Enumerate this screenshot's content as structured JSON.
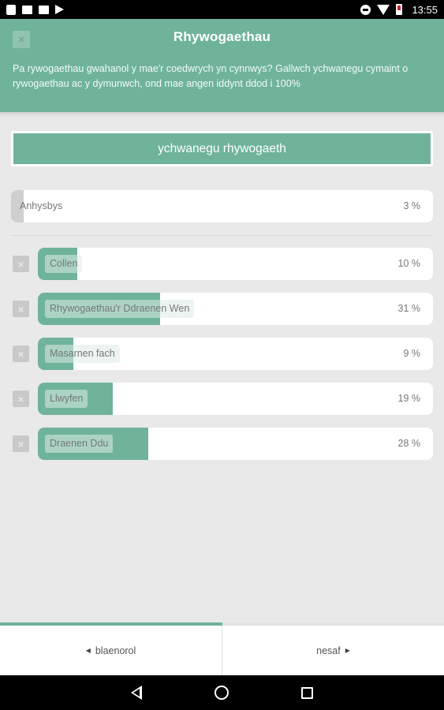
{
  "status_bar": {
    "time": "13:55",
    "left_icons": [
      "sim-icon",
      "image-icon",
      "gallery-icon",
      "play-store-icon"
    ],
    "right_icons": [
      "do-not-disturb-icon",
      "wifi-icon",
      "battery-icon"
    ]
  },
  "header": {
    "title": "Rhywogaethau",
    "description": "Pa rywogaethau gwahanol y mae'r coedwrych yn cynnwys? Gallwch ychwanegu cymaint o rywogaethau ac y dymunwch, ond mae angen iddynt ddod i 100%",
    "close_icon": "×"
  },
  "add_button": {
    "label": "ychwanegu rhywogaeth"
  },
  "unknown": {
    "label": "Anhysbys",
    "percent_label": "3 %",
    "percent": 3
  },
  "species": [
    {
      "label": "Collen",
      "percent_label": "10 %",
      "percent": 10
    },
    {
      "label": "Rhywogaethau'r Ddraenen Wen",
      "percent_label": "31 %",
      "percent": 31
    },
    {
      "label": "Masarnen fach",
      "percent_label": "9 %",
      "percent": 9
    },
    {
      "label": "Llwyfen",
      "percent_label": "19 %",
      "percent": 19
    },
    {
      "label": "Draenen Ddu",
      "percent_label": "28 %",
      "percent": 28
    }
  ],
  "remove_icon": "×",
  "progress": 0.5,
  "nav": {
    "previous_label": "blaenorol",
    "next_label": "nesaf",
    "previous_icon": "◀",
    "next_icon": "▶"
  },
  "colors": {
    "accent": "#6fb39b",
    "background": "#e9e9e9",
    "unknown_fill": "#cfcfcf"
  }
}
